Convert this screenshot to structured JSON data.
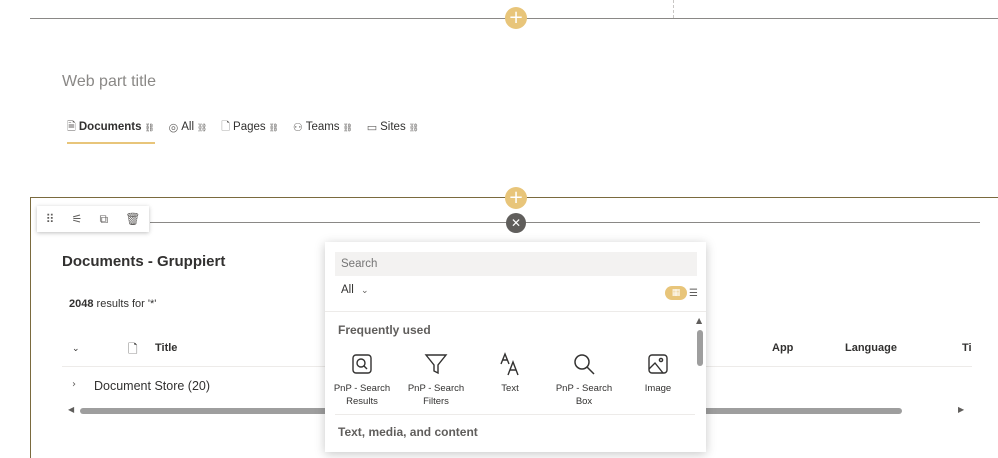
{
  "webpart": {
    "title": "Web part title"
  },
  "tabs": [
    {
      "label": "Documents",
      "icon": "document-icon",
      "active": true
    },
    {
      "label": "All",
      "icon": "globe-icon",
      "active": false
    },
    {
      "label": "Pages",
      "icon": "page-icon",
      "active": false
    },
    {
      "label": "Teams",
      "icon": "teams-icon",
      "active": false
    },
    {
      "label": "Sites",
      "icon": "sites-icon",
      "active": false
    }
  ],
  "section": {
    "title": "Documents - Gruppiert",
    "results_count": "2048",
    "results_suffix": " results for '*'",
    "columns": {
      "title": "Title",
      "app": "App",
      "language": "Language",
      "ti": "Ti"
    },
    "group_row": "Document Store (20)"
  },
  "picker": {
    "search_placeholder": "Search",
    "filter_label": "All",
    "frequently_used_label": "Frequently used",
    "text_media_label": "Text, media, and content",
    "tiles": [
      {
        "label": "PnP - Search Results",
        "icon": "search-results-icon"
      },
      {
        "label": "PnP - Search Filters",
        "icon": "filter-icon"
      },
      {
        "label": "Text",
        "icon": "text-icon"
      },
      {
        "label": "PnP - Search Box",
        "icon": "search-icon"
      },
      {
        "label": "Image",
        "icon": "image-icon"
      }
    ]
  },
  "colors": {
    "accent": "#e8c57a",
    "section_border": "#7a6a3e"
  }
}
